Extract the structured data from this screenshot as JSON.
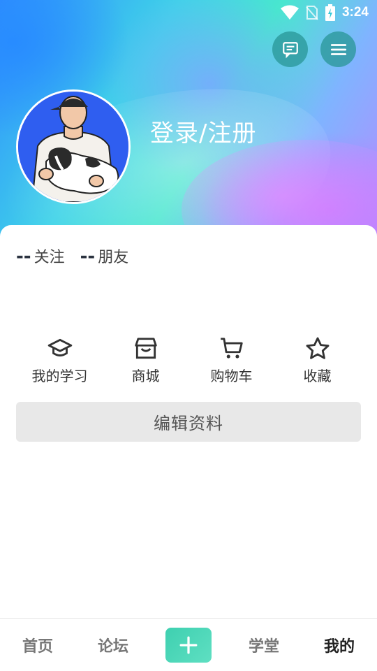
{
  "status_bar": {
    "time": "3:24",
    "icons": [
      "wifi-icon",
      "no-sim-icon",
      "battery-charging-icon"
    ]
  },
  "header": {
    "login_text": "登录/注册",
    "buttons": [
      "message-icon",
      "menu-icon"
    ],
    "gradient_colors": [
      "#2f8cff",
      "#49e6cf",
      "#b58bff"
    ]
  },
  "stats": [
    {
      "value": "--",
      "label": "关注"
    },
    {
      "value": "--",
      "label": "朋友"
    }
  ],
  "features": [
    {
      "icon": "graduation-cap-icon",
      "label": "我的学习"
    },
    {
      "icon": "store-icon",
      "label": "商城"
    },
    {
      "icon": "shopping-cart-icon",
      "label": "购物车"
    },
    {
      "icon": "star-icon",
      "label": "收藏"
    }
  ],
  "edit_profile_label": "编辑资料",
  "bottom_nav": {
    "items": [
      {
        "label": "首页"
      },
      {
        "label": "论坛"
      },
      {
        "label": "学堂"
      },
      {
        "label": "我的",
        "active": true
      }
    ],
    "add_icon": "plus-icon",
    "accent": "#3ed0b0"
  }
}
